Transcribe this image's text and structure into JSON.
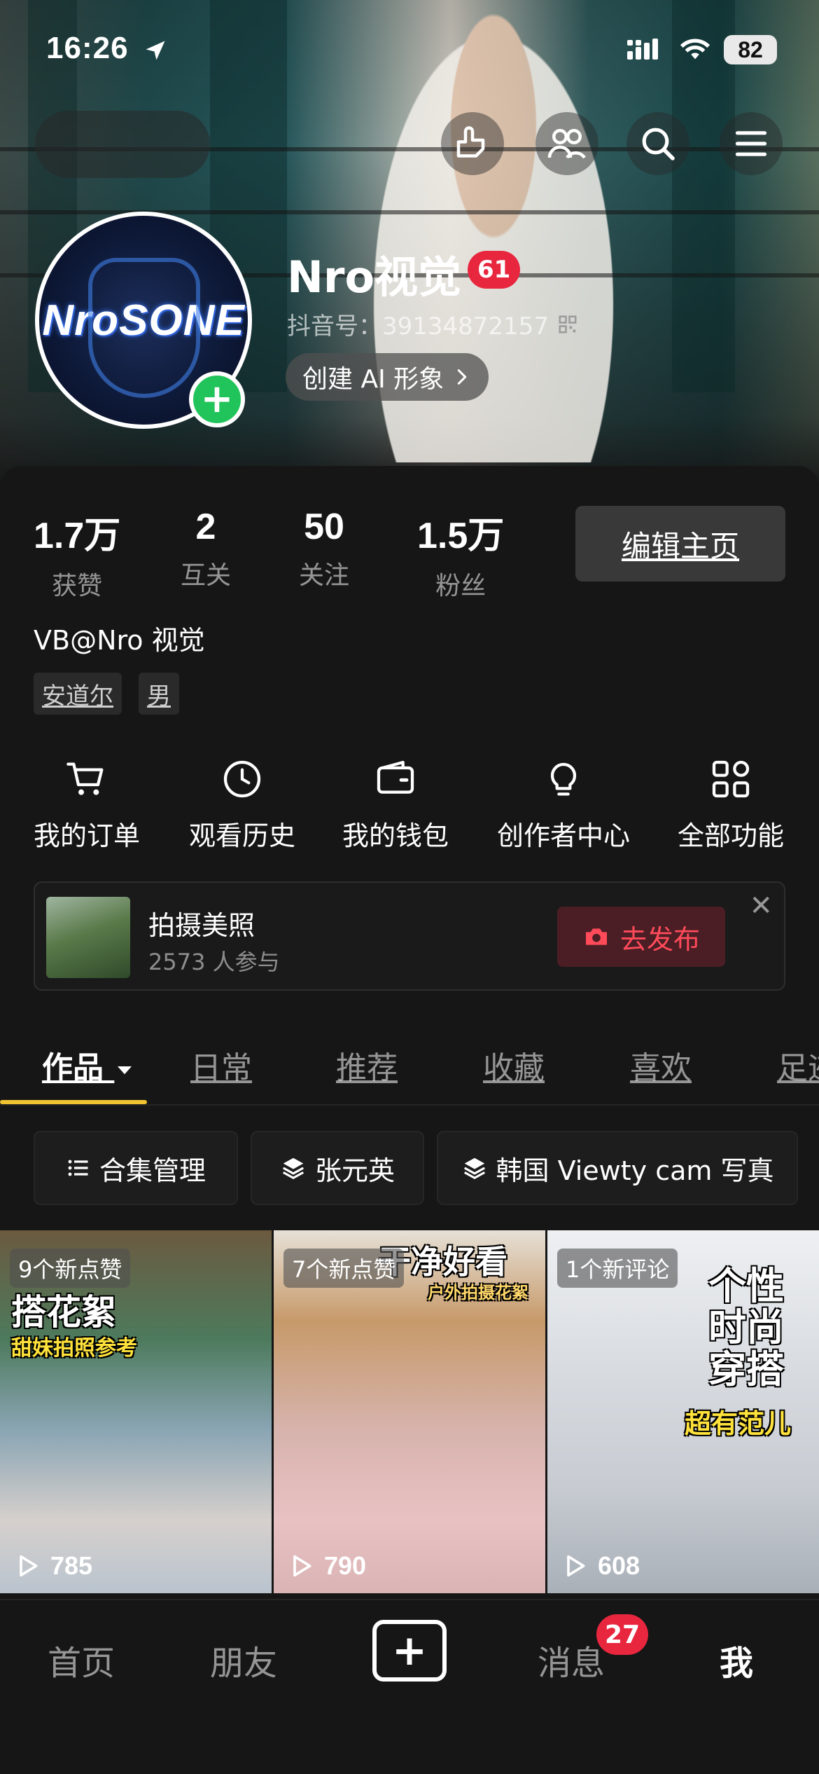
{
  "status_bar": {
    "time": "16:26",
    "battery": "82"
  },
  "profile": {
    "nickname": "Nro视觉",
    "level": "61",
    "douyin_id": "抖音号：39134872157",
    "ai_button": "创建 AI 形象",
    "avatar_text": "NroSONE"
  },
  "stats": [
    {
      "value": "1.7万",
      "label": "获赞"
    },
    {
      "value": "2",
      "label": "互关"
    },
    {
      "value": "50",
      "label": "关注"
    },
    {
      "value": "1.5万",
      "label": "粉丝"
    }
  ],
  "edit_button": "编辑主页",
  "bio": "VB@Nro 视觉",
  "tags": [
    "安道尔",
    "男"
  ],
  "tools": [
    {
      "label": "我的订单",
      "icon": "cart-icon"
    },
    {
      "label": "观看历史",
      "icon": "clock-icon"
    },
    {
      "label": "我的钱包",
      "icon": "wallet-icon"
    },
    {
      "label": "创作者中心",
      "icon": "bulb-icon"
    },
    {
      "label": "全部功能",
      "icon": "grid-icon"
    }
  ],
  "promo": {
    "title": "拍摄美照",
    "subtitle": "2573 人参与",
    "button": "去发布"
  },
  "tabs": [
    "作品",
    "日常",
    "推荐",
    "收藏",
    "喜欢",
    "足迹"
  ],
  "chips": [
    "合集管理",
    "张元英",
    "韩国 Viewty cam 写真"
  ],
  "videos": [
    {
      "badge": "9个新点赞",
      "plays": "785",
      "overlay": "搭花絮",
      "overlay2": "甜妹拍照参考"
    },
    {
      "badge": "7个新点赞",
      "plays": "790",
      "overlay": "干净好看",
      "overlay2": "户外拍摄花絮"
    },
    {
      "badge": "1个新评论",
      "plays": "608",
      "overlay": "个性时尚穿搭",
      "overlay2": "超有范儿"
    }
  ],
  "bottom_nav": {
    "home": "首页",
    "friends": "朋友",
    "messages": "消息",
    "messages_badge": "27",
    "me": "我"
  },
  "colors": {
    "accent": "#f0c330",
    "badge_red": "#e8273f",
    "add_green": "#21c45a"
  }
}
